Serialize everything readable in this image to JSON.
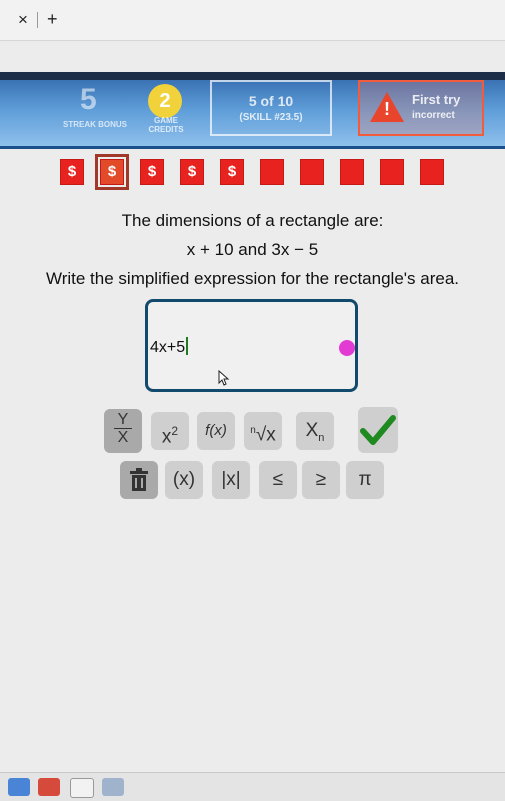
{
  "browser": {
    "close_glyph": "×",
    "new_tab_glyph": "+"
  },
  "header": {
    "streak_value": "5",
    "streak_label": "STREAK BONUS",
    "credits_value": "2",
    "credits_label": "GAME CREDITS",
    "progress": "5 of 10",
    "skill": "(SKILL #23.5)",
    "first_try_title": "First try",
    "first_try_sub": "incorrect",
    "warning_mark": "!"
  },
  "rewards": {
    "symbol": "$",
    "earned_count": 5,
    "total": 10,
    "selected_index": 1,
    "color": "#e8231f"
  },
  "question": {
    "line1": "The dimensions of a rectangle are:",
    "line2": "x + 10  and  3x − 5",
    "line3": "Write the simplified expression for the rectangle's area."
  },
  "answer": {
    "value": "4x+5",
    "indicator_color": "#e23ad2"
  },
  "keyboard": {
    "row1": [
      "Y/X",
      "x²",
      "f(x)",
      "ⁿ√x",
      "Xₙ",
      "✓"
    ],
    "row2": [
      "trash",
      "(x)",
      "|x|",
      "≤",
      "≥",
      "π"
    ],
    "frac_top": "Y",
    "frac_bottom": "X",
    "square": "x",
    "square_exp": "2",
    "function": "f(x)",
    "root_index": "n",
    "root": "√x",
    "subscript_base": "X",
    "subscript": "n",
    "parens": "(x)",
    "abs": "|x|",
    "leq": "≤",
    "geq": "≥",
    "pi": "π",
    "submit_color": "#1f8a1f"
  }
}
